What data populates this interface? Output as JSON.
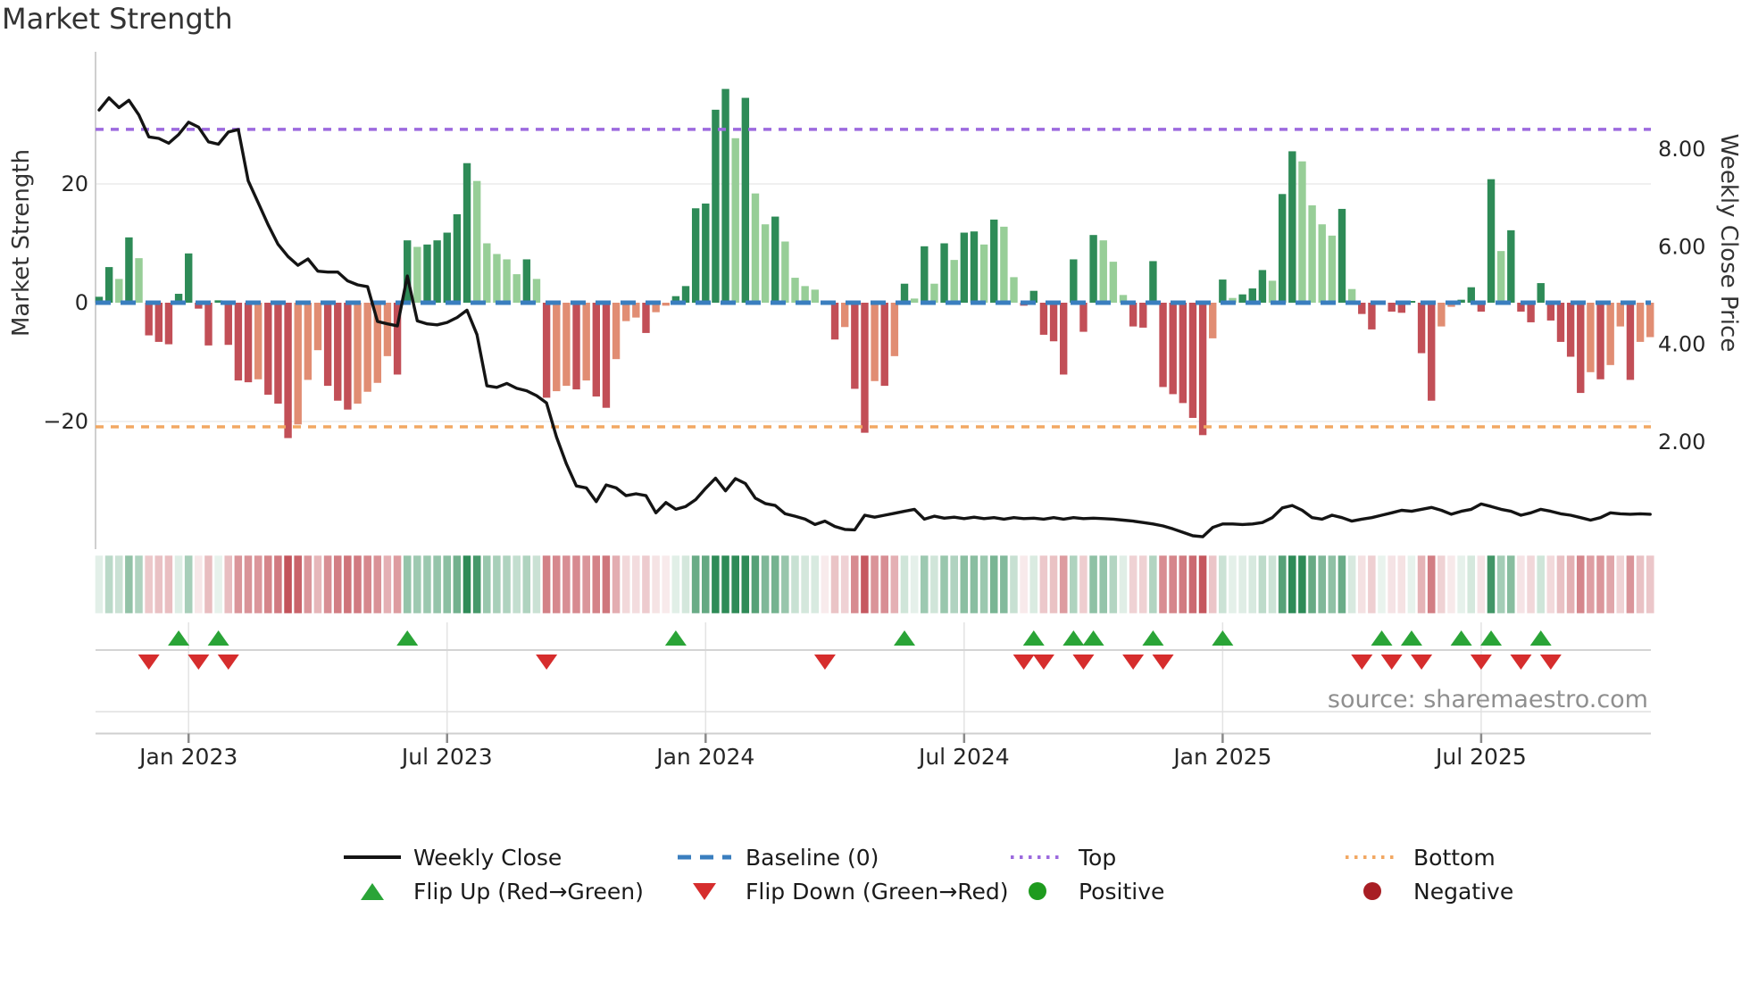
{
  "title": "Market Strength",
  "source": "source: sharemaestro.com",
  "colors": {
    "bar_pos_strong": "#2e8b57",
    "bar_pos_weak": "#97ce97",
    "bar_neg_strong": "#c24f57",
    "bar_neg_weak": "#e18d73",
    "price_line": "#141414",
    "baseline_blue": "#3a7ebf",
    "top_purple": "#9c6ade",
    "bottom_orange": "#f2a863",
    "flip_up_green": "#2aa437",
    "flip_down_red": "#d62d2d",
    "positive_dot": "#1e9b1e",
    "negative_dot": "#a81e24",
    "grid": "#ebebeb",
    "spine": "#cfcfcf",
    "axis_text": "#262626",
    "source_text": "#8f8f8f"
  },
  "chart_data": {
    "type": "bar+line",
    "title": "Market Strength",
    "left_axis": {
      "label": "Market Strength",
      "ticks": [
        {
          "value": 20,
          "label": "20"
        },
        {
          "value": 0,
          "label": "0"
        },
        {
          "value": -20,
          "label": "−20"
        }
      ]
    },
    "right_axis": {
      "label": "Weekly Close Price",
      "ticks": [
        {
          "value": 8,
          "label": "8.00"
        },
        {
          "value": 6,
          "label": "6.00"
        },
        {
          "value": 4,
          "label": "4.00"
        },
        {
          "value": 2,
          "label": "2.00"
        }
      ]
    },
    "x_axis": {
      "tick_weeks": [
        9,
        35,
        61,
        87,
        113,
        139
      ],
      "tick_labels": [
        "Jan 2023",
        "Jul 2023",
        "Jan 2024",
        "Jul 2024",
        "Jan 2025",
        "Jul 2025"
      ]
    },
    "baseline_value": 0,
    "top_line_value": 29.2,
    "bottom_line_value": -20.9,
    "series": [
      {
        "name": "Market Strength",
        "type": "bar",
        "values": [
          1.0,
          6.0,
          4.0,
          11.0,
          7.5,
          -5.5,
          -6.6,
          -7.0,
          1.5,
          8.3,
          -1.0,
          -7.2,
          0.4,
          -7.1,
          -13.1,
          -13.4,
          -12.9,
          -15.5,
          -17.0,
          -22.8,
          -20.5,
          -13.0,
          -8.0,
          -14.0,
          -16.5,
          -18.0,
          -17.0,
          -15.0,
          -13.5,
          -9.0,
          -12.1,
          10.5,
          9.4,
          9.8,
          10.5,
          11.8,
          14.9,
          23.5,
          20.5,
          10.0,
          8.2,
          7.3,
          4.8,
          7.3,
          4.0,
          -16.0,
          -14.9,
          -14.0,
          -14.6,
          -13.1,
          -15.8,
          -17.7,
          -9.5,
          -3.1,
          -2.5,
          -5.1,
          -1.6,
          -0.5,
          1.1,
          2.8,
          15.9,
          16.7,
          32.5,
          36.0,
          27.7,
          34.5,
          18.4,
          13.2,
          14.5,
          10.3,
          4.2,
          2.8,
          2.2,
          -0.3,
          -6.2,
          -4.1,
          -14.5,
          -21.9,
          -13.2,
          -14.0,
          -9.0,
          3.2,
          0.7,
          9.5,
          3.2,
          10.0,
          7.2,
          11.8,
          12.0,
          9.8,
          14.0,
          12.8,
          4.3,
          -0.5,
          2.0,
          -5.4,
          -6.5,
          -12.1,
          7.3,
          -4.9,
          11.4,
          10.5,
          6.9,
          1.3,
          -4.0,
          -4.2,
          7.0,
          -14.2,
          -15.4,
          -16.9,
          -19.4,
          -22.3,
          -6.0,
          3.9,
          0.8,
          1.4,
          2.4,
          5.5,
          3.7,
          18.3,
          25.5,
          23.8,
          16.4,
          13.2,
          11.3,
          15.8,
          2.3,
          -1.9,
          -4.5,
          0.1,
          -1.5,
          -1.7,
          0.3,
          -8.5,
          -16.5,
          -4.0,
          -0.7,
          0.5,
          2.6,
          -1.5,
          20.8,
          8.7,
          12.2,
          -1.5,
          -3.3,
          3.3,
          -3.0,
          -6.6,
          -9.1,
          -15.2,
          -11.7,
          -12.9,
          -10.5,
          -4.0,
          -13.0,
          -6.6,
          -5.8
        ]
      },
      {
        "name": "Weekly Close",
        "type": "line",
        "values": [
          8.8,
          9.05,
          8.85,
          9.0,
          8.7,
          8.25,
          8.22,
          8.12,
          8.3,
          8.55,
          8.45,
          8.15,
          8.1,
          8.35,
          8.4,
          7.35,
          6.9,
          6.45,
          6.05,
          5.8,
          5.62,
          5.75,
          5.5,
          5.48,
          5.48,
          5.3,
          5.22,
          5.18,
          4.47,
          4.42,
          4.38,
          5.4,
          4.48,
          4.42,
          4.4,
          4.45,
          4.55,
          4.7,
          4.2,
          3.15,
          3.12,
          3.2,
          3.1,
          3.05,
          2.95,
          2.8,
          2.1,
          1.55,
          1.1,
          1.06,
          0.78,
          1.12,
          1.06,
          0.9,
          0.94,
          0.9,
          0.55,
          0.76,
          0.62,
          0.68,
          0.82,
          1.05,
          1.26,
          1.0,
          1.25,
          1.15,
          0.85,
          0.74,
          0.7,
          0.53,
          0.48,
          0.42,
          0.31,
          0.38,
          0.27,
          0.21,
          0.2,
          0.5,
          0.46,
          0.5,
          0.54,
          0.58,
          0.62,
          0.42,
          0.48,
          0.44,
          0.46,
          0.43,
          0.46,
          0.43,
          0.45,
          0.42,
          0.45,
          0.43,
          0.44,
          0.42,
          0.45,
          0.42,
          0.45,
          0.43,
          0.44,
          0.43,
          0.42,
          0.4,
          0.38,
          0.35,
          0.32,
          0.28,
          0.22,
          0.15,
          0.08,
          0.06,
          0.25,
          0.32,
          0.32,
          0.31,
          0.32,
          0.35,
          0.45,
          0.65,
          0.7,
          0.6,
          0.45,
          0.42,
          0.5,
          0.45,
          0.38,
          0.42,
          0.45,
          0.5,
          0.55,
          0.6,
          0.58,
          0.62,
          0.66,
          0.6,
          0.52,
          0.58,
          0.62,
          0.73,
          0.68,
          0.62,
          0.58,
          0.5,
          0.55,
          0.62,
          0.58,
          0.53,
          0.5,
          0.45,
          0.4,
          0.45,
          0.55,
          0.53,
          0.52,
          0.53,
          0.52
        ]
      }
    ],
    "flip_up_weeks": [
      8,
      12,
      31,
      58,
      81,
      94,
      98,
      100,
      106,
      113,
      129,
      132,
      137,
      140,
      145
    ],
    "flip_down_weeks": [
      5,
      10,
      13,
      45,
      73,
      93,
      95,
      99,
      104,
      107,
      127,
      130,
      133,
      139,
      143,
      146
    ],
    "panels": [
      "main",
      "heatmap-strip",
      "flip-markers"
    ],
    "grid": "horizontal at ±20, vertical date lines in marker panel",
    "legend_position": "bottom"
  },
  "legend": {
    "rows": [
      [
        {
          "label": "Weekly Close",
          "swatch": "solid-line",
          "color": "#141414"
        },
        {
          "label": "Baseline (0)",
          "swatch": "dashed-line",
          "color": "#3a7ebf"
        },
        {
          "label": "Top",
          "swatch": "dotted-line",
          "color": "#9c6ade"
        },
        {
          "label": "Bottom",
          "swatch": "dotted-line",
          "color": "#f2a863"
        }
      ],
      [
        {
          "label": "Flip Up (Red→Green)",
          "swatch": "triangle-up",
          "color": "#2aa437"
        },
        {
          "label": "Flip Down (Green→Red)",
          "swatch": "triangle-down",
          "color": "#d62d2d"
        },
        {
          "label": "Positive",
          "swatch": "circle",
          "color": "#1e9b1e"
        },
        {
          "label": "Negative",
          "swatch": "circle",
          "color": "#a81e24"
        }
      ]
    ]
  }
}
